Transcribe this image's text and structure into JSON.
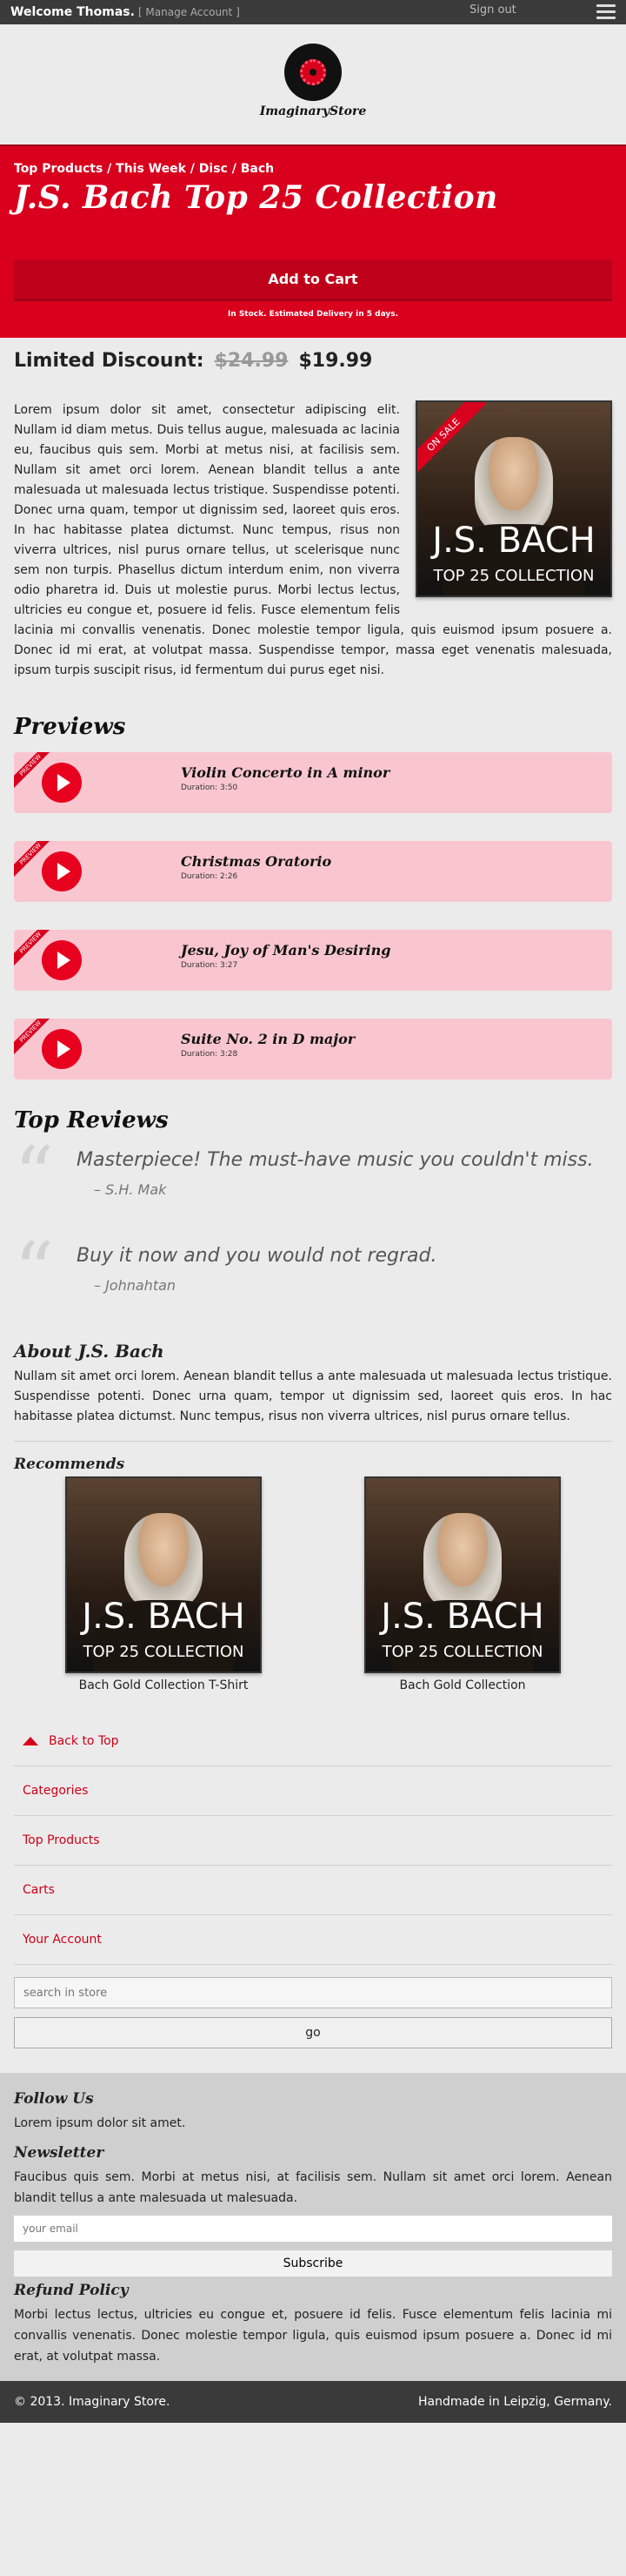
{
  "topbar": {
    "welcome": "Welcome Thomas.",
    "manage": "[ Manage Account ]",
    "signout": "Sign out"
  },
  "logo": {
    "text": "ImaginaryStore"
  },
  "hero": {
    "breadcrumb": "Top Products / This Week / Disc / Bach",
    "title": "J.S. Bach Top 25 Collection",
    "cart_label": "Add to Cart",
    "stock": "In Stock. Estimated Delivery in 5 days."
  },
  "discount": {
    "label": "Limited Discount:",
    "old_price": "$24.99",
    "new_price": "$19.99"
  },
  "album": {
    "ribbon": "ON SALE",
    "title": "J.S. BACH",
    "subtitle": "TOP 25 COLLECTION"
  },
  "description": "Lorem ipsum dolor sit amet, consectetur adipiscing elit. Nullam id diam metus. Duis tellus augue, malesuada ac lacinia eu, faucibus quis sem. Morbi at metus nisi, at facilisis sem. Nullam sit amet orci lorem. Aenean blandit tellus a ante malesuada ut malesuada lectus tristique. Suspendisse potenti. Donec urna quam, tempor ut dignissim sed, laoreet quis eros. In hac habitasse platea dictumst. Nunc tempus, risus non viverra ultrices, nisl purus ornare tellus, ut scelerisque nunc sem non turpis. Phasellus dictum interdum enim, non viverra odio pharetra id. Duis ut molestie purus. Morbi lectus lectus, ultricies eu congue et, posuere id felis. Fusce elementum felis lacinia mi convallis venenatis. Donec molestie tempor ligula, quis euismod ipsum posuere a. Donec id mi erat, at volutpat massa. Suspendisse tempor, massa eget venenatis malesuada, ipsum turpis suscipit risus, id fermentum dui purus eget nisi.",
  "previews": {
    "heading": "Previews",
    "tag": "PREVIEW",
    "items": [
      {
        "title": "Violin Concerto in A minor",
        "duration": "Duration: 3:50"
      },
      {
        "title": "Christmas Oratorio",
        "duration": "Duration: 2:26"
      },
      {
        "title": "Jesu, Joy of Man's Desiring",
        "duration": "Duration: 3:27"
      },
      {
        "title": "Suite No. 2 in D major",
        "duration": "Duration: 3:28"
      }
    ]
  },
  "reviews": {
    "heading": "Top Reviews",
    "items": [
      {
        "text": "Masterpiece! The must-have music you couldn't miss.",
        "author": "– S.H. Mak"
      },
      {
        "text": "Buy it now and you would not regrad.",
        "author": "– Johnahtan"
      }
    ]
  },
  "about": {
    "heading": "About J.S. Bach",
    "text": "Nullam sit amet orci lorem. Aenean blandit tellus a ante malesuada ut malesuada lectus tristique. Suspendisse potenti. Donec urna quam, tempor ut dignissim sed, laoreet quis eros. In hac habitasse platea dictumst. Nunc tempus, risus non viverra ultrices, nisl purus ornare tellus."
  },
  "recommends": {
    "heading": "Recommends",
    "items": [
      {
        "name": "Bach Gold Collection T-Shirt"
      },
      {
        "name": "Bach Gold Collection"
      }
    ]
  },
  "nav": {
    "back_to_top": "Back to Top",
    "categories": "Categories",
    "top_products": "Top Products",
    "carts": "Carts",
    "account": "Your Account"
  },
  "search": {
    "placeholder": "search in store",
    "go": "go"
  },
  "footer": {
    "follow_heading": "Follow Us",
    "follow_text": "Lorem ipsum dolor sit amet.",
    "newsletter_heading": "Newsletter",
    "newsletter_text": "Faucibus quis sem. Morbi at metus nisi, at facilisis sem. Nullam sit amet orci lorem. Aenean blandit tellus a ante malesuada ut malesuada.",
    "email_placeholder": "your email",
    "subscribe": "Subscribe",
    "refund_heading": "Refund Policy",
    "refund_text": "Morbi lectus lectus, ultricies eu congue et, posuere id felis. Fusce elementum felis lacinia mi convallis venenatis. Donec molestie tempor ligula, quis euismod ipsum posuere a. Donec id mi erat, at volutpat massa.",
    "copyright": "© 2013. Imaginary Store.",
    "handmade": "Handmade in Leipzig, Germany."
  },
  "colors": {
    "accent": "#d9001e",
    "preview_bg": "#f9c6d0",
    "topbar": "#3a3a3a"
  }
}
